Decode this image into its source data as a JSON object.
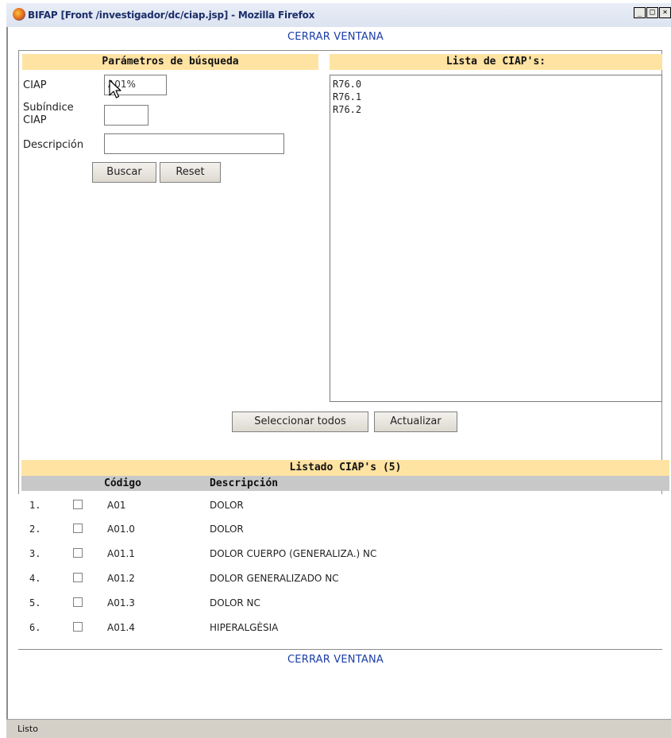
{
  "window": {
    "title": "BIFAP [Front /investigador/dc/ciap.jsp] - Mozilla Firefox",
    "controls": [
      "_",
      "□",
      "×"
    ]
  },
  "close_link_top": "CERRAR VENTANA",
  "close_link_bottom": "CERRAR VENTANA",
  "search": {
    "header": "Parámetros de búsqueda",
    "ciap_label": "CIAP",
    "ciap_value": "A01%",
    "subindex_label_1": "Subíndice",
    "subindex_label_2": "CIAP",
    "subindex_value": "",
    "description_label": "Descripción",
    "description_value": "",
    "search_button": "Buscar",
    "reset_button": "Reset"
  },
  "ciap_list": {
    "header": "Lista de CIAP's:",
    "items": [
      "R76.0",
      "R76.1",
      "R76.2"
    ]
  },
  "actions": {
    "select_all_button": "Seleccionar todos",
    "update_button": "Actualizar"
  },
  "listing": {
    "header": "Listado CIAP's (5)",
    "col_code": "Código",
    "col_description": "Descripción",
    "rows": [
      {
        "num": "1.",
        "code": "A01",
        "desc": "DOLOR"
      },
      {
        "num": "2.",
        "code": "A01.0",
        "desc": "DOLOR"
      },
      {
        "num": "3.",
        "code": "A01.1",
        "desc": "DOLOR CUERPO (GENERALIZA.) NC"
      },
      {
        "num": "4.",
        "code": "A01.2",
        "desc": "DOLOR GENERALIZADO NC"
      },
      {
        "num": "5.",
        "code": "A01.3",
        "desc": "DOLOR NC"
      },
      {
        "num": "6.",
        "code": "A01.4",
        "desc": "HIPERALGÈSIA"
      }
    ]
  },
  "status": {
    "text": "Listo"
  },
  "colors": {
    "header_yellow": "#ffe3a3",
    "link_blue": "#1a3da8",
    "gray_bar": "#c8c8c8"
  }
}
